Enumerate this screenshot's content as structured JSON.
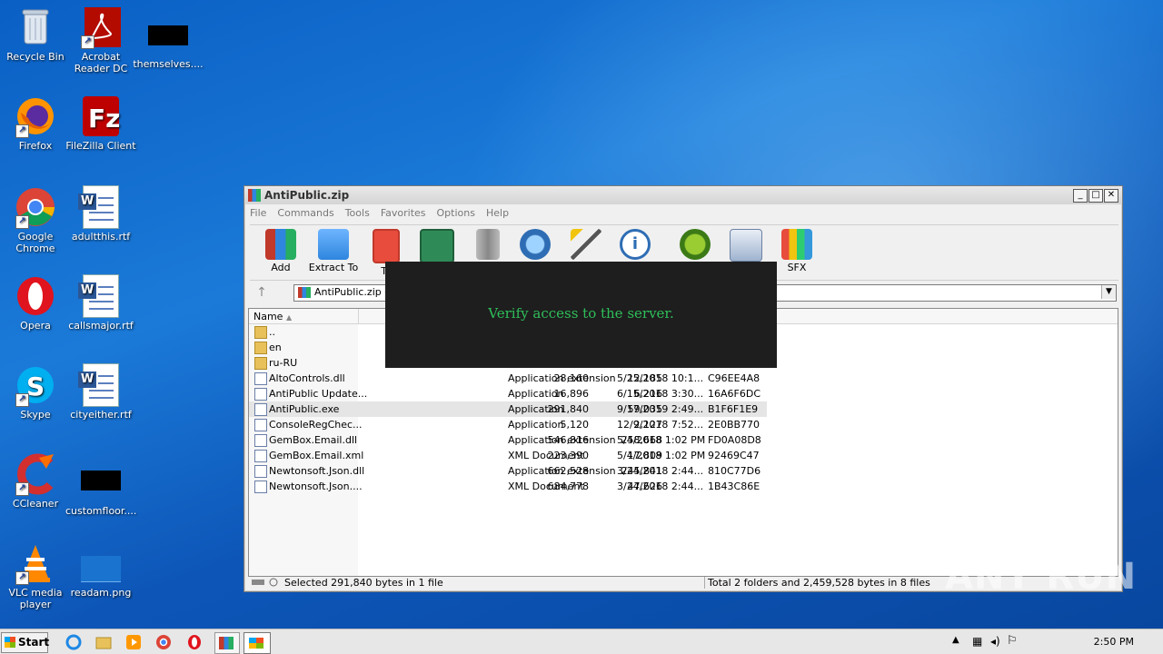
{
  "desktop": {
    "icons": [
      {
        "label": "Recycle Bin"
      },
      {
        "label": "Acrobat Reader DC"
      },
      {
        "label": "themselves...."
      },
      {
        "label": "Firefox"
      },
      {
        "label": "FileZilla Client"
      },
      {
        "label": "Google Chrome"
      },
      {
        "label": "adultthis.rtf"
      },
      {
        "label": "Opera"
      },
      {
        "label": "callsmajor.rtf"
      },
      {
        "label": "Skype"
      },
      {
        "label": "cityeither.rtf"
      },
      {
        "label": "CCleaner"
      },
      {
        "label": "customfloor...."
      },
      {
        "label": "VLC media player"
      },
      {
        "label": "readam.png"
      }
    ]
  },
  "window": {
    "title": "AntiPublic.zip",
    "menu": [
      "File",
      "Commands",
      "Tools",
      "Favorites",
      "Options",
      "Help"
    ],
    "toolbar": [
      {
        "label": "Add",
        "icon": "add-icon"
      },
      {
        "label": "Extract To",
        "icon": "extract-icon"
      },
      {
        "label": "Te",
        "icon": "test-icon"
      },
      {
        "label": "",
        "icon": "view-icon"
      },
      {
        "label": "",
        "icon": "delete-icon"
      },
      {
        "label": "",
        "icon": "find-icon"
      },
      {
        "label": "",
        "icon": "wizard-icon"
      },
      {
        "label": "",
        "icon": "info-icon"
      },
      {
        "label": "",
        "icon": "virusscan-icon"
      },
      {
        "label": "",
        "icon": "comment-icon"
      },
      {
        "label": "SFX",
        "icon": "sfx-icon"
      }
    ],
    "address": "AntiPublic.zip - Z",
    "columns": [
      "Name"
    ],
    "rows": [
      {
        "name": "..",
        "size": "",
        "packed": "",
        "type": "",
        "modified": "",
        "crc": "",
        "kind": "folder"
      },
      {
        "name": "en",
        "size": "",
        "packed": "",
        "type": "",
        "modified": "",
        "crc": "",
        "kind": "folder"
      },
      {
        "name": "ru-RU",
        "size": "",
        "packed": "",
        "type": "",
        "modified": "",
        "crc": "",
        "kind": "folder"
      },
      {
        "name": "AltoControls.dll",
        "size": "28,160",
        "packed": "12,185",
        "type": "Application extension",
        "modified": "5/25/2018 10:1...",
        "crc": "C96EE4A8",
        "kind": "file"
      },
      {
        "name": "AntiPublic Update...",
        "size": "16,896",
        "packed": "6,216",
        "type": "Application",
        "modified": "6/15/2018 3:30...",
        "crc": "16A6F6DC",
        "kind": "file"
      },
      {
        "name": "AntiPublic.exe",
        "size": "291,840",
        "packed": "59,035",
        "type": "Application",
        "modified": "9/17/2019 2:49...",
        "crc": "B1F6F1E9",
        "kind": "file",
        "selected": true
      },
      {
        "name": "ConsoleRegChec...",
        "size": "5,120",
        "packed": "2,127",
        "type": "Application",
        "modified": "12/9/2018 7:52...",
        "crc": "2E0BB770",
        "kind": "file"
      },
      {
        "name": "GemBox.Email.dll",
        "size": "546,816",
        "packed": "258,668",
        "type": "Application extension",
        "modified": "5/4/2018 1:02 PM",
        "crc": "FD0A08D8",
        "kind": "file"
      },
      {
        "name": "GemBox.Email.xml",
        "size": "223,390",
        "packed": "17,809",
        "type": "XML Document",
        "modified": "5/4/2018 1:02 PM",
        "crc": "92469C47",
        "kind": "file"
      },
      {
        "name": "Newtonsoft.Json.dll",
        "size": "662,528",
        "packed": "245,841",
        "type": "Application extension",
        "modified": "3/24/2018 2:44...",
        "crc": "810C77D6",
        "kind": "file"
      },
      {
        "name": "Newtonsoft.Json....",
        "size": "684,778",
        "packed": "47,626",
        "type": "XML Document",
        "modified": "3/24/2018 2:44...",
        "crc": "1B43C86E",
        "kind": "file"
      }
    ],
    "status_left": "Selected 291,840 bytes in 1 file",
    "status_right": "Total 2 folders and 2,459,528 bytes in 8 files"
  },
  "overlay": {
    "message": "Verify access to the server."
  },
  "watermark": "ANY RUN",
  "taskbar": {
    "start_label": "Start",
    "clock": "2:50 PM"
  }
}
